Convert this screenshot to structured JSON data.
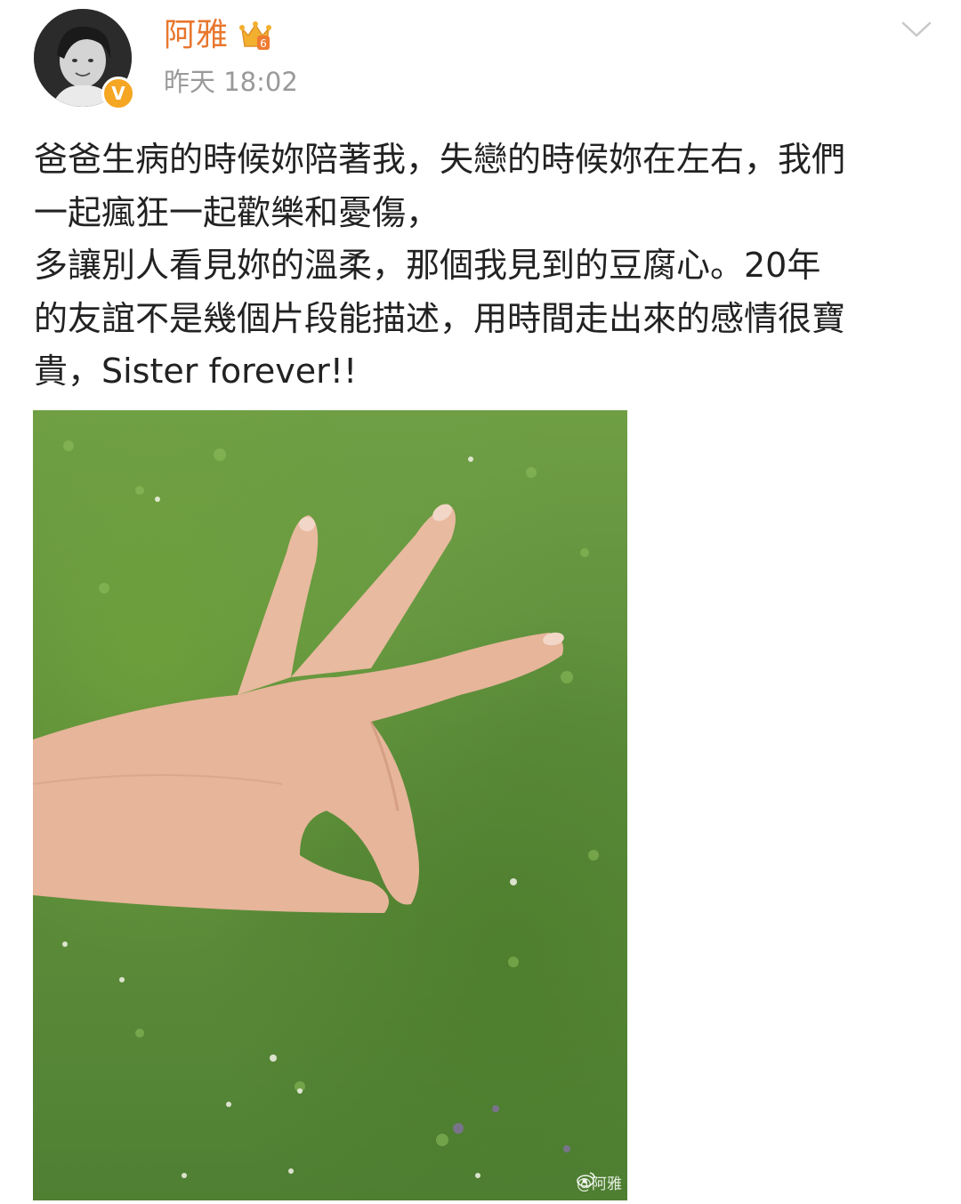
{
  "post": {
    "username": "阿雅",
    "timestamp": "昨天 18:02",
    "verified_badge": "V",
    "vip_level": "6",
    "text": "爸爸生病的時候妳陪著我，失戀的時候妳在左右，我們\n一起瘋狂一起歡樂和憂傷，\n多讓別人看見妳的溫柔，那個我見到的豆腐心。20年\n的友誼不是幾個片段能描述，用時間走出來的感情很寶\n貴，Sister forever!!",
    "image_watermark": "@阿雅"
  },
  "icons": {
    "more": "chevron-down-icon",
    "vip": "crown-icon",
    "verified": "verified-badge-icon",
    "watermark_logo": "weibo-logo-icon"
  },
  "colors": {
    "username": "#e8762d",
    "timestamp": "#999999",
    "text": "#222222",
    "verified": "#f5a623",
    "grass": "#5c8d3a"
  }
}
